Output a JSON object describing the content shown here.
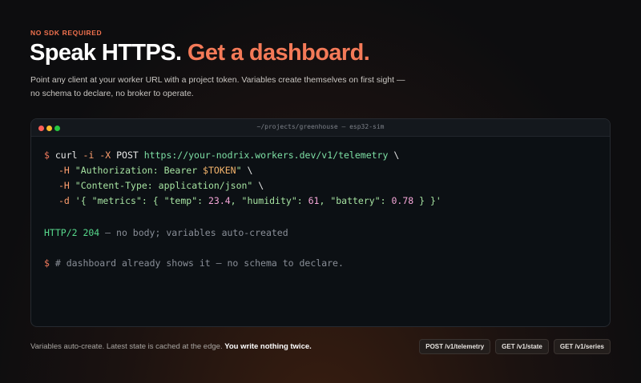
{
  "hero": {
    "eyebrow": "NO SDK REQUIRED",
    "headline_part1": "Speak HTTPS.",
    "headline_part2": "Get a dashboard.",
    "description": "Point any client at your worker URL with a project token. Variables create themselves on first sight — no schema to declare, no broker to operate."
  },
  "terminal": {
    "title": "~/projects/greenhouse — esp32-sim",
    "lines": {
      "l1": {
        "prompt": "$",
        "cmd": "curl",
        "flag1": "-i",
        "flag2": "-X",
        "method": "POST",
        "url": "https://your-nodrix.workers.dev/v1/telemetry",
        "cont": "\\"
      },
      "l2": {
        "flag": "-H",
        "str_a": "\"Authorization: Bearer ",
        "var": "$TOKEN",
        "str_b": "\"",
        "cont": "\\"
      },
      "l3": {
        "flag": "-H",
        "str": "\"Content-Type: application/json\"",
        "cont": "\\"
      },
      "l4": {
        "flag": "-d",
        "p1": "'{ \"metrics\": { \"temp\": ",
        "n1": "23.4",
        "p2": ", \"humidity\": ",
        "n2": "61",
        "p3": ", \"battery\": ",
        "n3": "0.78",
        "p4": " } }'"
      },
      "l5": {
        "status": "HTTP/2 204",
        "note": " — no body; variables auto-created"
      },
      "l6": {
        "prompt": "$",
        "comment": "# dashboard already shows it — no schema to declare."
      }
    }
  },
  "footer": {
    "text": "Variables auto-create. Latest state is cached at the edge.",
    "emphasis": "You write nothing twice.",
    "chips": [
      "POST /v1/telemetry",
      "GET /v1/state",
      "GET /v1/series"
    ]
  },
  "colors": {
    "accent": "#f47a58",
    "background": "#0f0e10",
    "terminal_bg": "#0c1014"
  }
}
